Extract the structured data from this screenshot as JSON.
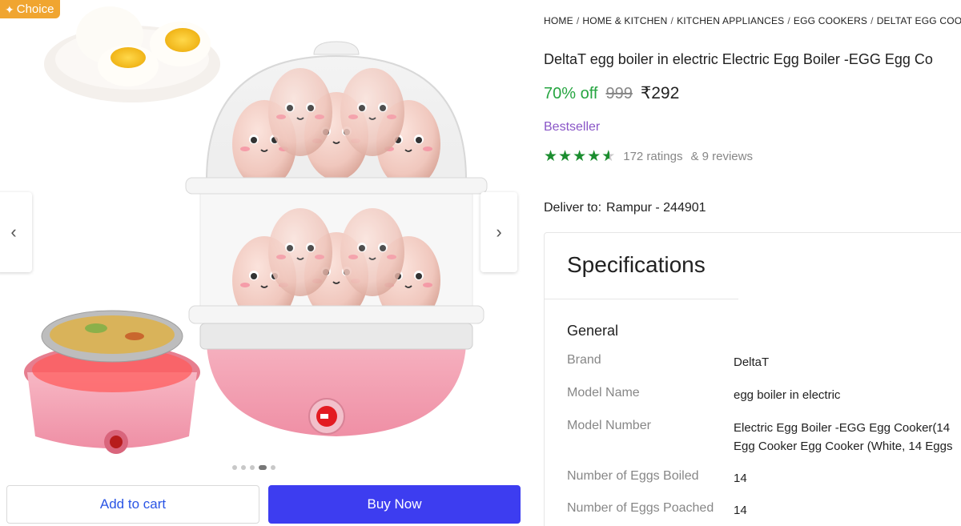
{
  "badge": {
    "label": "Choice",
    "icon": "sparkle-icon",
    "color": "#f0a530"
  },
  "gallery": {
    "prev_icon": "‹",
    "next_icon": "›",
    "dots_total": 5,
    "active_dot": 4
  },
  "actions": {
    "add_to_cart": "Add to cart",
    "buy_now": "Buy Now"
  },
  "breadcrumb": [
    "HOME",
    "HOME & KITCHEN",
    "KITCHEN APPLIANCES",
    "EGG COOKERS",
    "DELTAT EGG COOKERS"
  ],
  "product": {
    "title": "DeltaT egg boiler in electric Electric Egg Boiler -EGG Egg Co",
    "discount": "70% off",
    "mrp": "999",
    "price": "₹292",
    "tag": "Bestseller",
    "rating_value": 4.5,
    "ratings": "172 ratings",
    "reviews": "& 9 reviews"
  },
  "delivery": {
    "label": "Deliver to:",
    "location": "Rampur - 244901"
  },
  "specifications": {
    "heading": "Specifications",
    "section": "General",
    "rows": [
      {
        "key": "Brand",
        "value": "DeltaT"
      },
      {
        "key": "Model Name",
        "value": "egg boiler in electric"
      },
      {
        "key": "Model Number",
        "value": "Electric Egg Boiler -EGG Egg Cooker(14",
        "value2": "Egg Cooker Egg Cooker (White, 14 Eggs"
      },
      {
        "key": "Number of Eggs Boiled",
        "value": "14"
      },
      {
        "key": "Number of Eggs Poached",
        "value": "14"
      }
    ]
  },
  "colors": {
    "discount": "#26a541",
    "buy_button": "#3d3df0",
    "bestseller": "#8a56c7",
    "stars": "#1b8d2f"
  }
}
